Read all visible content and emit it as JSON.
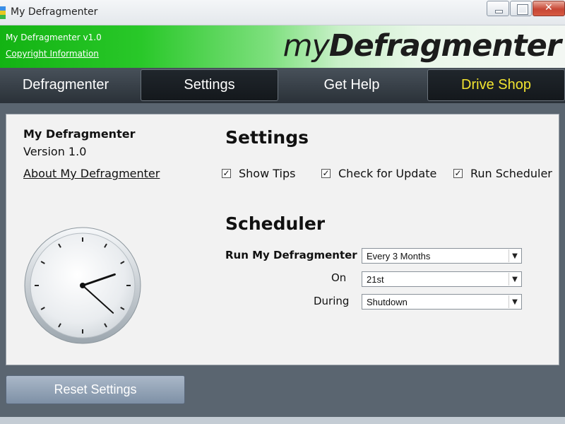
{
  "window": {
    "title": "My Defragmenter",
    "icon": "app-icon"
  },
  "header": {
    "version_line": "My Defragmenter v1.0",
    "copyright_link": "Copyright Information",
    "logo_my": "my",
    "logo_defrag": "Defragmenter",
    "colors": {
      "start": "#13b313",
      "end": "#f3f7f3"
    }
  },
  "nav": {
    "tabs": [
      {
        "label": "Defragmenter"
      },
      {
        "label": "Settings"
      },
      {
        "label": "Get Help"
      },
      {
        "label": "Drive Shop",
        "color": "#f2e430"
      }
    ]
  },
  "about": {
    "app_name": "My Defragmenter",
    "version": "Version 1.0",
    "about_link": "About My Defragmenter"
  },
  "settings": {
    "title": "Settings",
    "options": [
      {
        "label": "Show Tips",
        "checked": true
      },
      {
        "label": "Check for Update",
        "checked": true
      },
      {
        "label": "Run Scheduler",
        "checked": true
      }
    ]
  },
  "scheduler": {
    "title": "Scheduler",
    "run_label": "Run My Defragmenter",
    "on_label": "On",
    "during_label": "During",
    "frequency": "Every 3 Months",
    "day": "21st",
    "during": "Shutdown"
  },
  "clock": {
    "hour": 2,
    "minute": 22
  },
  "footer": {
    "reset_label": "Reset Settings"
  }
}
